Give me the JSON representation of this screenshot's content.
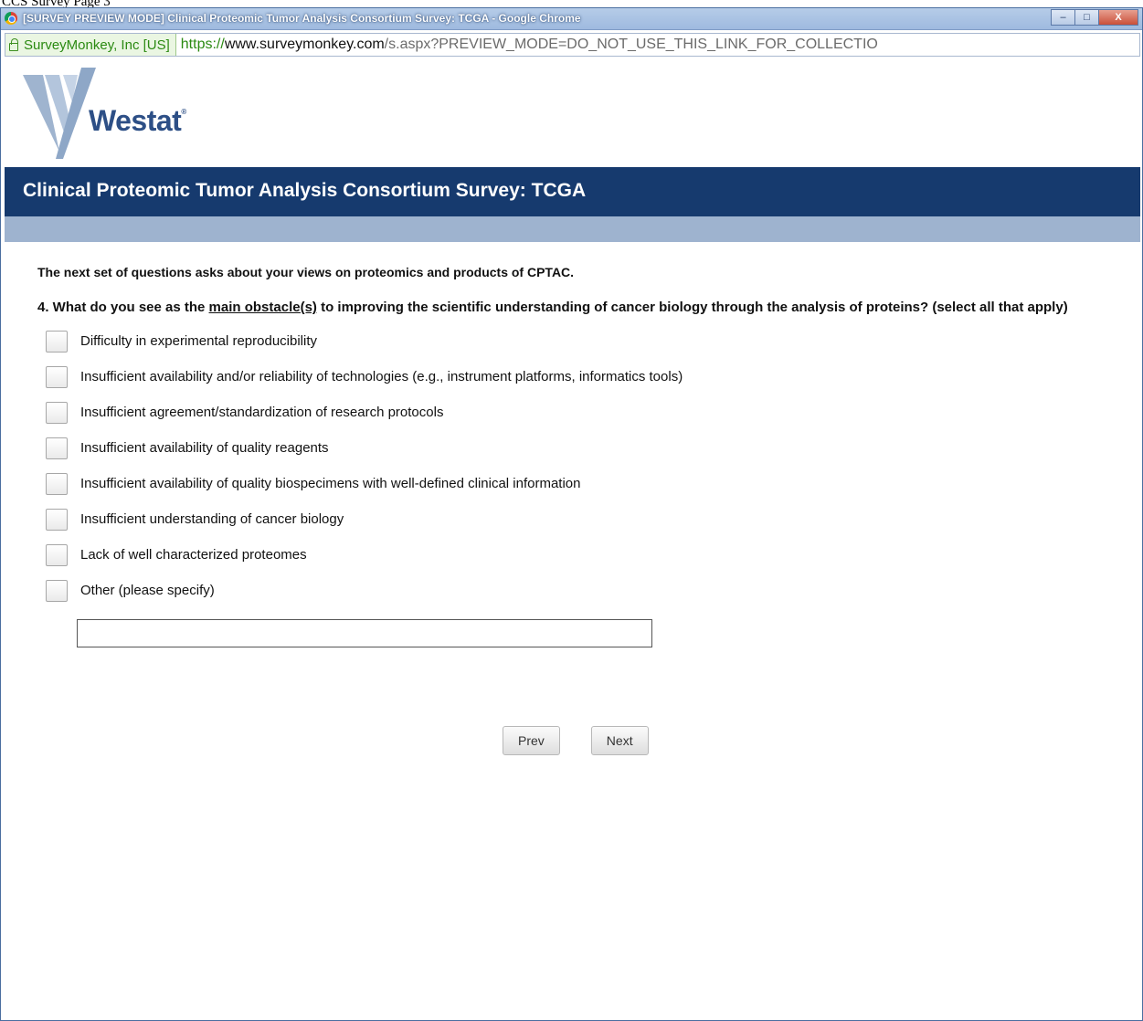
{
  "page_caption": "CCS Survey Page 3",
  "window": {
    "title": "[SURVEY PREVIEW MODE] Clinical Proteomic Tumor Analysis Consortium Survey: TCGA - Google Chrome",
    "controls": {
      "minimize": "–",
      "maximize": "□",
      "close": "X"
    }
  },
  "addressbar": {
    "site_identity": "SurveyMonkey, Inc [US]",
    "url_scheme": "https://",
    "url_host": "www.surveymonkey.com",
    "url_path": "/s.aspx?PREVIEW_MODE=DO_NOT_USE_THIS_LINK_FOR_COLLECTIO"
  },
  "brand": {
    "name": "Westat",
    "tm": "®",
    "accent": "#2d4f86"
  },
  "header": {
    "title": "Clinical Proteomic Tumor Analysis Consortium Survey: TCGA",
    "color": "#163a6e"
  },
  "intro": "The next set of questions asks about your views on proteomics and products of CPTAC.",
  "question": {
    "prefix": "4. What do you see as the ",
    "emphasis": "main obstacle(s)",
    "suffix": " to improving the scientific understanding of cancer biology through the analysis of proteins? (select all that apply)"
  },
  "options": [
    "Difficulty in experimental reproducibility",
    "Insufficient availability and/or reliability of technologies (e.g., instrument platforms, informatics tools)",
    "Insufficient agreement/standardization of research protocols",
    "Insufficient availability of quality reagents",
    "Insufficient availability of quality biospecimens with well-defined clinical information",
    "Insufficient understanding of cancer biology",
    "Lack of well characterized proteomes",
    "Other (please specify)"
  ],
  "other_input": {
    "value": ""
  },
  "navigation": {
    "prev_label": "Prev",
    "next_label": "Next"
  }
}
